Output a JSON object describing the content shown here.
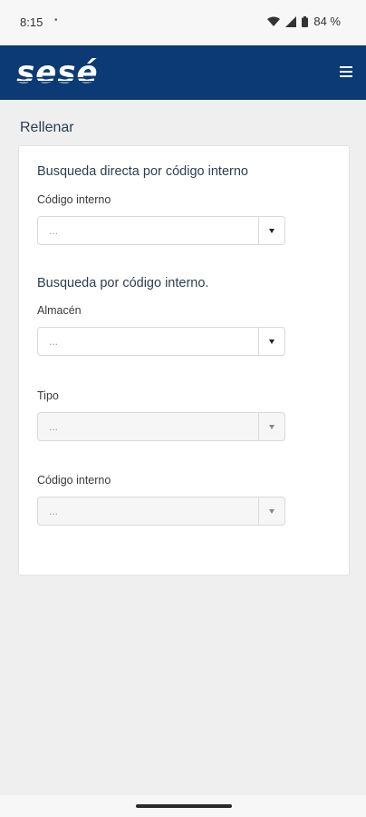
{
  "status_bar": {
    "time": "8:15",
    "notification_dot": "•",
    "battery_text": "84 %",
    "icons": [
      "wifi-icon",
      "cellular-signal-icon",
      "battery-icon"
    ]
  },
  "app_bar": {
    "logo_text": "sesé",
    "menu_icon": "hamburger-menu-icon",
    "background_color": "#0b3a75"
  },
  "page": {
    "title": "Rellenar"
  },
  "form": {
    "direct_search": {
      "heading": "Busqueda directa por código interno",
      "code_label": "Código interno",
      "code_value": "..."
    },
    "code_search": {
      "heading": "Busqueda por código interno.",
      "warehouse_label": "Almacén",
      "warehouse_value": "...",
      "type_label": "Tipo",
      "type_value": "...",
      "code_label": "Código interno",
      "code_value": "..."
    }
  }
}
